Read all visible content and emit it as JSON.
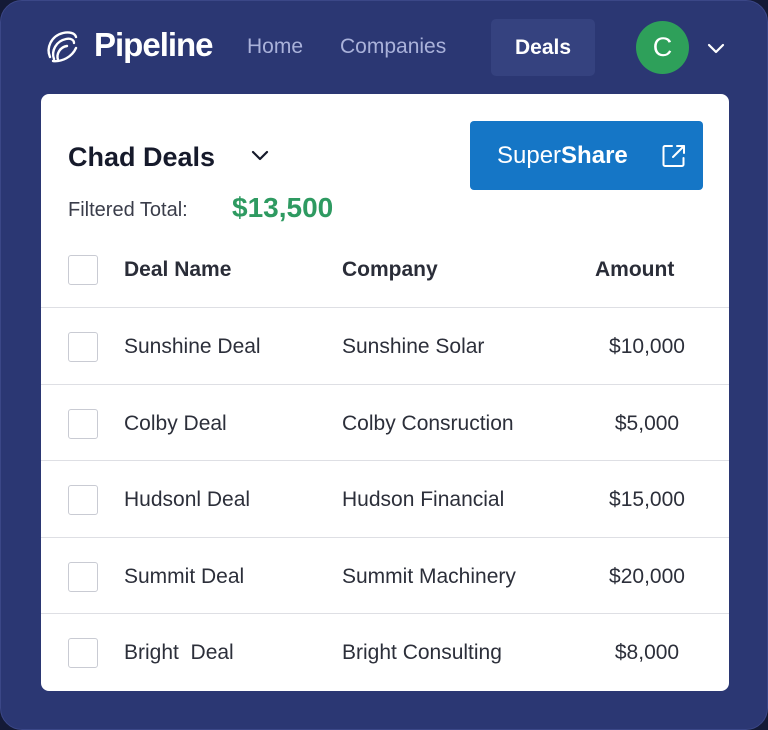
{
  "nav": {
    "brand": "Pipeline",
    "links": [
      "Home",
      "Companies"
    ],
    "active": "Deals",
    "avatar_initial": "C"
  },
  "card": {
    "title": "Chad Deals",
    "share_button": {
      "prefix": "Super",
      "bold": "Share"
    },
    "filtered_label": "Filtered Total:",
    "filtered_value": "$13,500"
  },
  "table": {
    "headers": {
      "name": "Deal Name",
      "company": "Company",
      "amount": "Amount"
    },
    "rows": [
      {
        "name": "Sunshine Deal",
        "company": "Sunshine Solar",
        "amount": "$10,000"
      },
      {
        "name": "Colby Deal",
        "company": "Colby Consruction",
        "amount": "$5,000"
      },
      {
        "name": "Hudsonl Deal",
        "company": "Hudson Financial",
        "amount": "$15,000"
      },
      {
        "name": "Summit Deal",
        "company": "Summit Machinery",
        "amount": "$20,000"
      },
      {
        "name": "Bright  Deal",
        "company": "Bright Consulting",
        "amount": "$8,000"
      }
    ]
  },
  "colors": {
    "background": "#2b3773",
    "accent": "#1576c6",
    "total": "#2e9a61",
    "avatar": "#2ea05a"
  },
  "icons": [
    "pipeline-logo-icon",
    "chevron-down-icon",
    "external-link-icon"
  ]
}
